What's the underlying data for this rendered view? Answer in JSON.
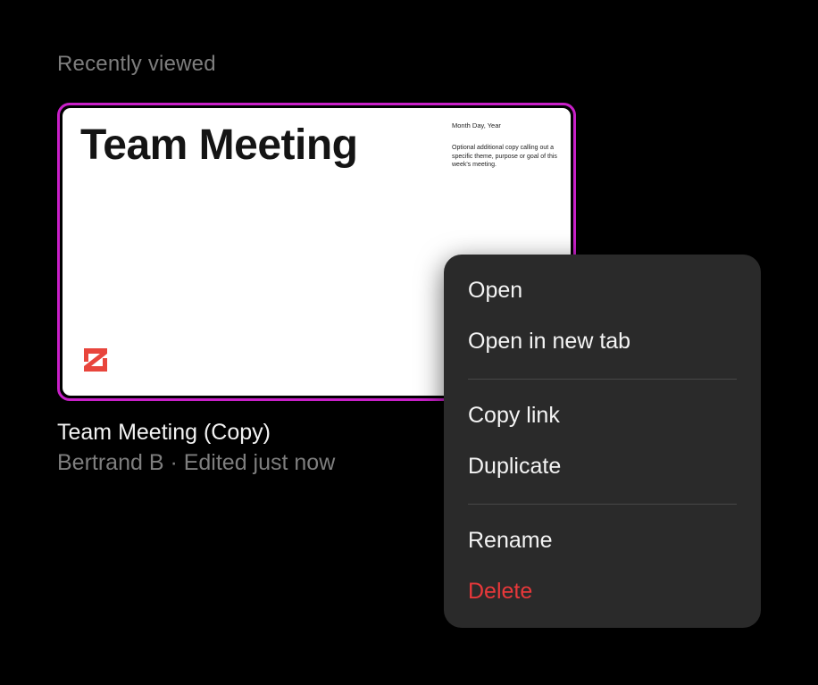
{
  "section": {
    "heading": "Recently viewed"
  },
  "file_card": {
    "thumbnail": {
      "title": "Team Meeting",
      "date_text": "Month Day, Year",
      "description": "Optional additional copy calling out a specific theme, purpose or goal of this week's meeting.",
      "logo_color": "#e8453c"
    },
    "name": "Team Meeting (Copy)",
    "meta": "Bertrand B · Edited just now",
    "selected_border_color": "#c920c9"
  },
  "context_menu": {
    "groups": [
      [
        {
          "label": "Open"
        },
        {
          "label": "Open in new tab"
        }
      ],
      [
        {
          "label": "Copy link"
        },
        {
          "label": "Duplicate"
        }
      ],
      [
        {
          "label": "Rename"
        },
        {
          "label": "Delete",
          "danger": true
        }
      ]
    ],
    "danger_color": "#e8383a"
  }
}
